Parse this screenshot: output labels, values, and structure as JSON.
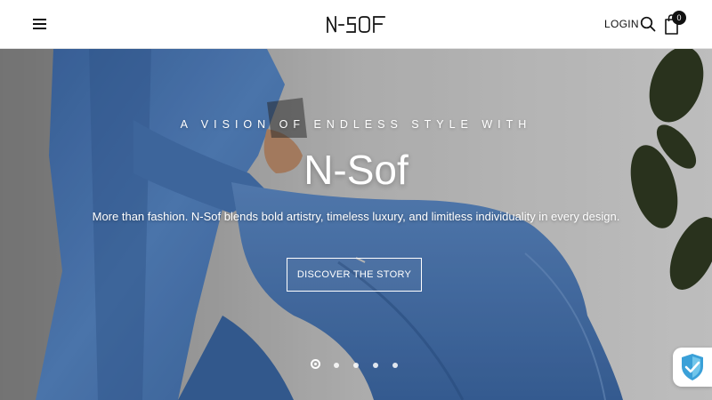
{
  "header": {
    "menu_icon": "hamburger-menu-icon",
    "logo_text": "N-SOF",
    "login_label": "LOGIN",
    "search_icon": "search-icon",
    "cart_icon": "shopping-bag-icon",
    "cart_count": "0"
  },
  "hero": {
    "eyebrow": "A VISION OF ENDLESS STYLE WITH",
    "title": "N-Sof",
    "subtitle": "More than fashion. N-Sof blends bold artistry, timeless luxury, and limitless individuality in every design.",
    "cta_label": "DISCOVER THE STORY",
    "slides_total": 5,
    "active_slide": 1
  },
  "trust_badge": {
    "icon": "shield-check-icon"
  },
  "colors": {
    "denim": "#4a76b6",
    "background": "#d6d6d6",
    "header_bg": "#ffffff",
    "text_dark": "#111111"
  }
}
